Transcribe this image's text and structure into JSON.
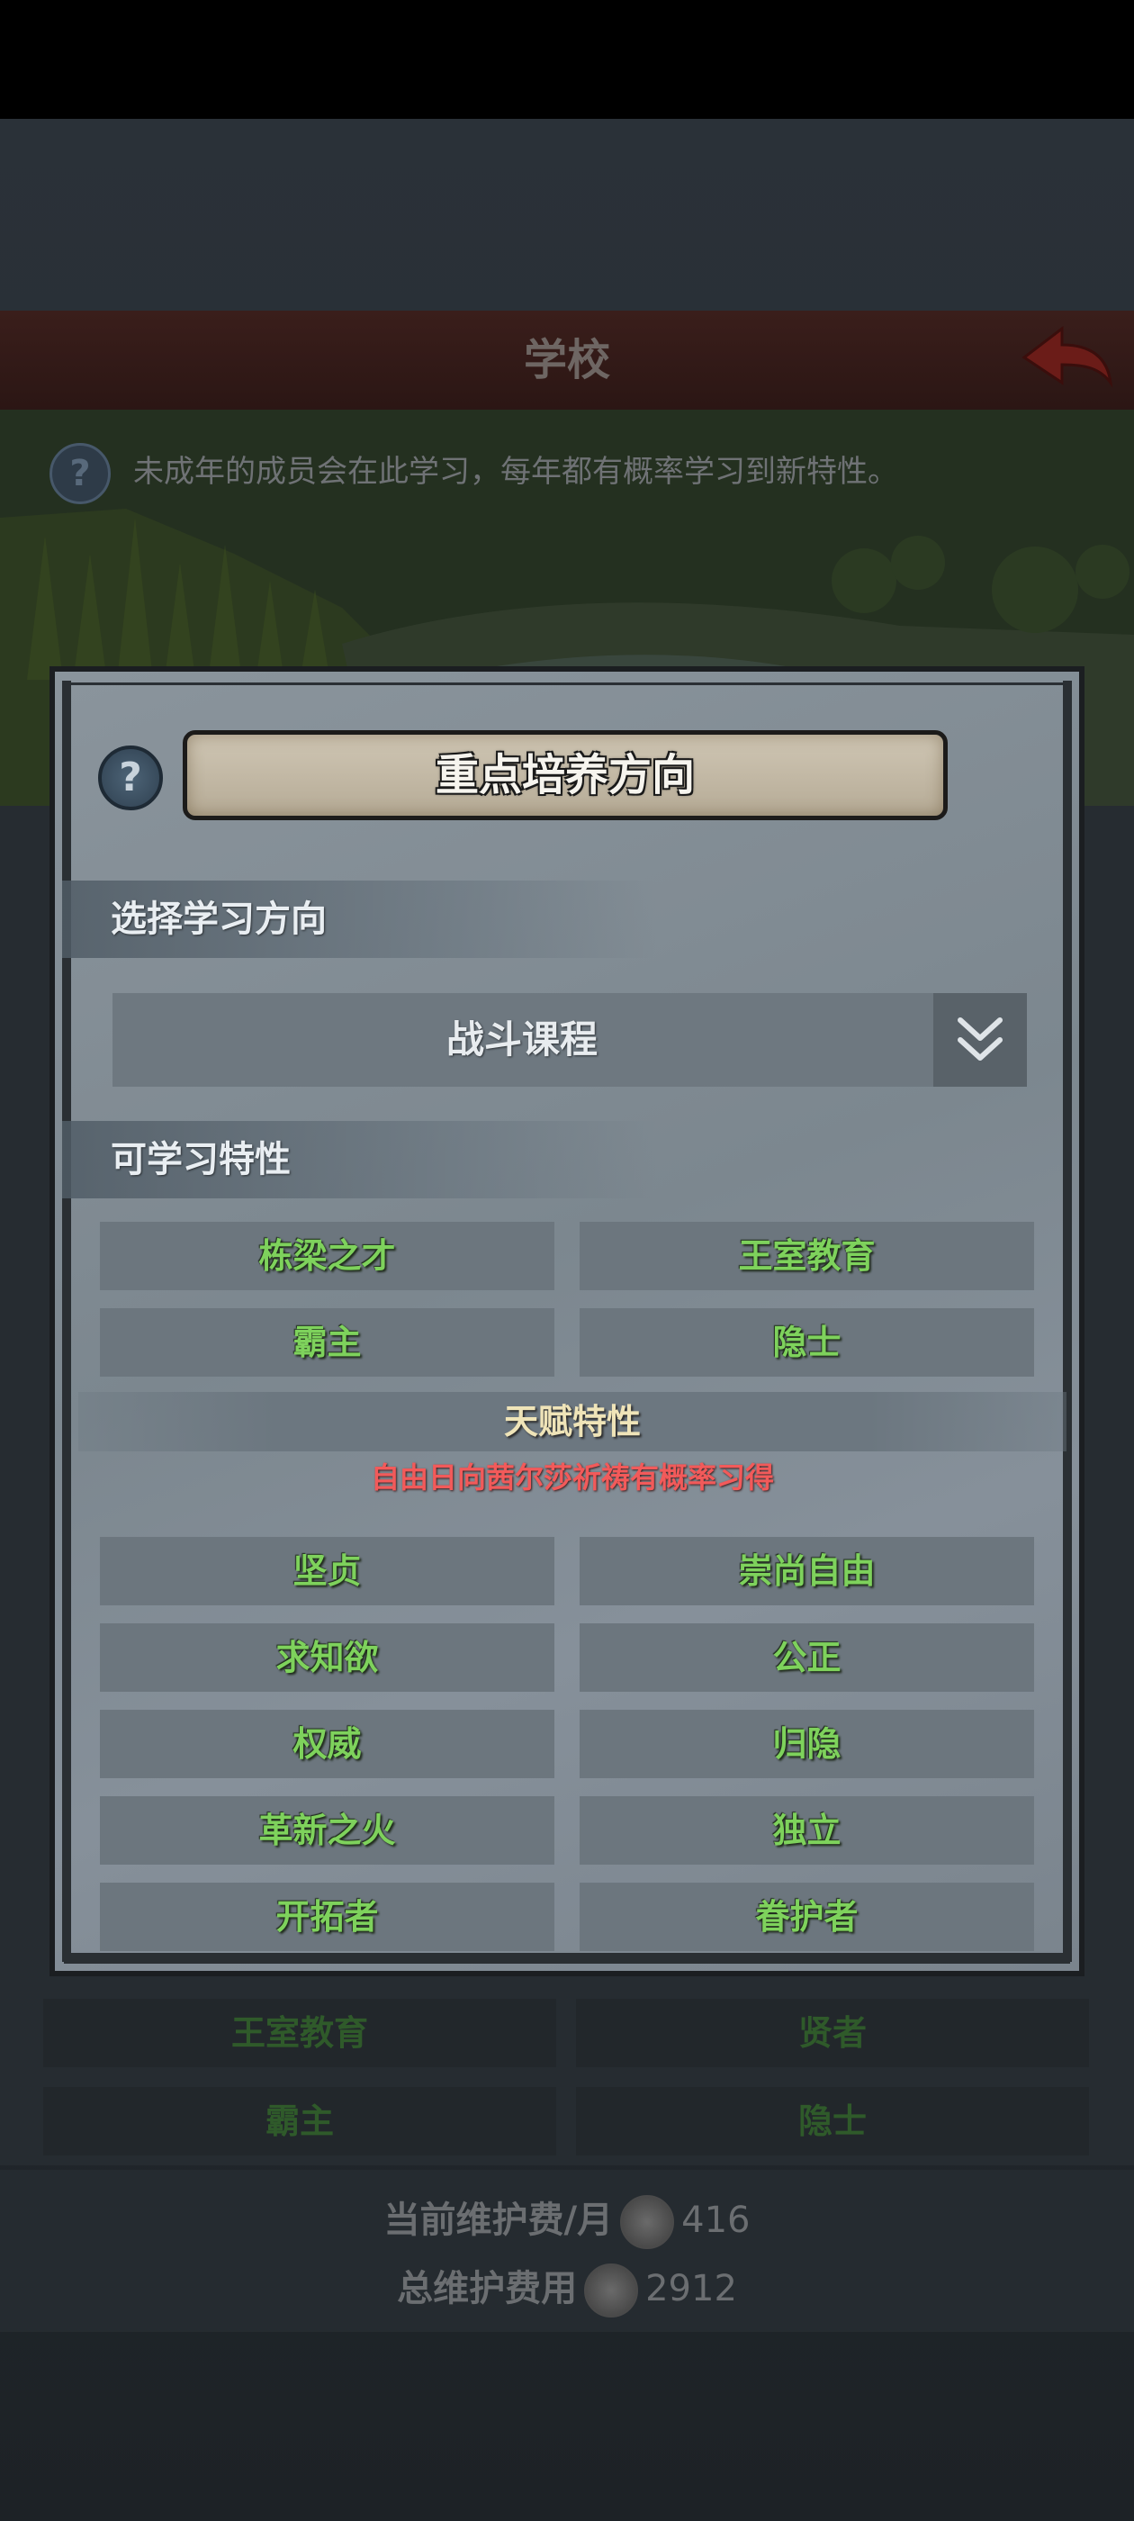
{
  "background": {
    "header_title": "学校",
    "info_text": "未成年的成员会在此学习，每年都有概率学习到新特性。",
    "trait_grid": [
      [
        "王室教育",
        "贤者"
      ],
      [
        "霸主",
        "隐士"
      ]
    ],
    "footer": {
      "monthly_label": "当前维护费/月",
      "monthly_value": "416",
      "total_label": "总维护费用",
      "total_value": "2912"
    }
  },
  "modal": {
    "title": "重点培养方向",
    "select_section_label": "选择学习方向",
    "dropdown_value": "战斗课程",
    "learnable_section_label": "可学习特性",
    "learnable_traits": [
      [
        "栋梁之才",
        "王室教育"
      ],
      [
        "霸主",
        "隐士"
      ]
    ],
    "talent_title": "天赋特性",
    "talent_note": "自由日向茜尔莎祈祷有概率习得",
    "talent_traits": [
      [
        "坚贞",
        "崇尚自由"
      ],
      [
        "求知欲",
        "公正"
      ],
      [
        "权威",
        "归隐"
      ],
      [
        "革新之火",
        "独立"
      ],
      [
        "开拓者",
        "眷护者"
      ]
    ]
  },
  "colors": {
    "trait_text": "#7ed25c",
    "talent_note": "#f25a5a",
    "talent_title": "#efe4b8",
    "header_bg": "#3a1e1b"
  },
  "icons": {
    "help": "question-circle-icon",
    "dropdown": "double-chevron-down-icon",
    "back": "back-arrow-icon",
    "coin": "silver-coin-icon"
  }
}
